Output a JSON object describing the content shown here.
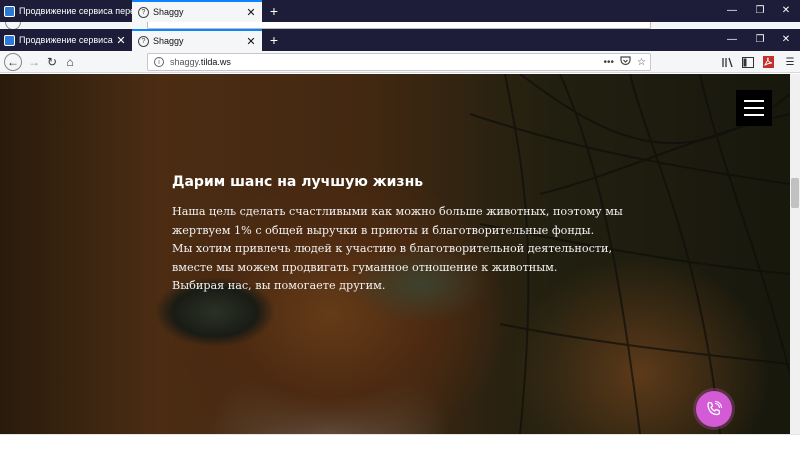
{
  "browser": {
    "tabs": [
      {
        "label": "Продвижение сервиса перед"
      },
      {
        "label": "Shaggy"
      }
    ],
    "url_prefix": "shaggy.",
    "url_host": "tilda.ws",
    "url_more": "•••"
  },
  "hero": {
    "title": "Дарим шанс на лучшую жизнь",
    "lines": [
      "Наша цель сделать счастливыми как можно больше животных, поэтому мы",
      "жертвуем 1% с общей выручки в приюты и благотворительные фонды.",
      "Мы хотим привлечь людей к участию в благотворительной деятельности,",
      "вместе мы можем продвигать гуманное отношение к животным.",
      "Выбирая нас, вы помогаете другим."
    ]
  },
  "colors": {
    "call_button": "#d45bd6",
    "menu_button": "#000000",
    "tab_bar": "#1d1d3a"
  },
  "icons": [
    "back-arrow-icon",
    "forward-arrow-icon",
    "reload-icon",
    "home-icon",
    "site-info-icon",
    "pocket-icon",
    "bookmark-star-icon",
    "library-icon",
    "sidebar-icon",
    "pdf-icon",
    "menu-icon",
    "hamburger-icon",
    "phone-icon"
  ]
}
